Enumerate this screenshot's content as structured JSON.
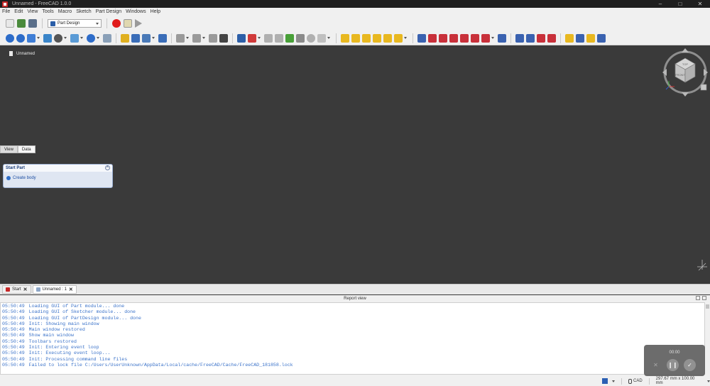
{
  "window": {
    "title": "Unnamed - FreeCAD 1.0.0"
  },
  "menu": [
    "File",
    "Edit",
    "View",
    "Tools",
    "Macro",
    "Sketch",
    "Part Design",
    "Windows",
    "Help"
  ],
  "workbench": {
    "selected": "Part Design"
  },
  "document": {
    "name": "Unnamed"
  },
  "panel_tabs": [
    "View",
    "Data"
  ],
  "task_panel": {
    "title": "Start Part",
    "action": "Create body"
  },
  "navcube": {
    "face_top": "TOP",
    "face_front": "FRONT"
  },
  "mdi_tabs": [
    {
      "label": "Start"
    },
    {
      "label": "Unnamed : 1"
    }
  ],
  "report": {
    "title": "Report view",
    "lines": [
      {
        "time": "05:50:49",
        "msg": "Loading GUI of Part module... done"
      },
      {
        "time": "05:50:49",
        "msg": "Loading GUI of Sketcher module... done"
      },
      {
        "time": "05:50:49",
        "msg": "Loading GUI of PartDesign module... done"
      },
      {
        "time": "05:50:49",
        "msg": "Init: Showing main window"
      },
      {
        "time": "05:50:49",
        "msg": "Main window restored"
      },
      {
        "time": "05:50:49",
        "msg": "Show main window"
      },
      {
        "time": "05:50:49",
        "msg": "Toolbars restored"
      },
      {
        "time": "05:50:49",
        "msg": "Init: Entering event loop"
      },
      {
        "time": "05:50:49",
        "msg": "Init: Executing event loop..."
      },
      {
        "time": "05:50:49",
        "msg": "Init: Processing command line files"
      },
      {
        "time": "05:50:49",
        "msg": "Failed to lock file C:/Users/UserUnknown/AppData/Local/cache/FreeCAD/Cache/FreeCAD_181858.lock"
      }
    ]
  },
  "status": {
    "nav_style": "CAD",
    "dimensions": "297.67 mm x 100.00 mm"
  },
  "recorder": {
    "time": "00:00"
  },
  "colors": {
    "view_bg": "#3a3a3a",
    "accent": "#2b5fb3",
    "record": "#e01b1b",
    "log_text": "#3a72c9"
  }
}
